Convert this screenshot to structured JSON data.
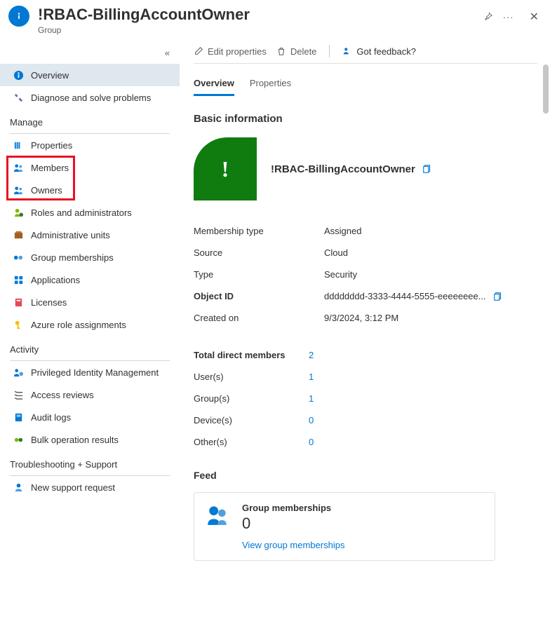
{
  "header": {
    "title": "!RBAC-BillingAccountOwner",
    "subtitle": "Group"
  },
  "sidebar": {
    "items": [
      {
        "label": "Overview",
        "icon": "info",
        "active": true
      },
      {
        "label": "Diagnose and solve problems",
        "icon": "wrench"
      }
    ],
    "manage_heading": "Manage",
    "manage": [
      {
        "label": "Properties",
        "icon": "props"
      },
      {
        "label": "Members",
        "icon": "people"
      },
      {
        "label": "Owners",
        "icon": "people"
      },
      {
        "label": "Roles and administrators",
        "icon": "role"
      },
      {
        "label": "Administrative units",
        "icon": "adminunit"
      },
      {
        "label": "Group memberships",
        "icon": "groupmem"
      },
      {
        "label": "Applications",
        "icon": "apps"
      },
      {
        "label": "Licenses",
        "icon": "license"
      },
      {
        "label": "Azure role assignments",
        "icon": "key"
      }
    ],
    "activity_heading": "Activity",
    "activity": [
      {
        "label": "Privileged Identity Management",
        "icon": "pim"
      },
      {
        "label": "Access reviews",
        "icon": "checklist"
      },
      {
        "label": "Audit logs",
        "icon": "book"
      },
      {
        "label": "Bulk operation results",
        "icon": "bulk"
      }
    ],
    "support_heading": "Troubleshooting + Support",
    "support": [
      {
        "label": "New support request",
        "icon": "support"
      }
    ]
  },
  "toolbar": {
    "edit": "Edit properties",
    "delete": "Delete",
    "feedback": "Got feedback?"
  },
  "tabs": {
    "overview": "Overview",
    "properties": "Properties"
  },
  "basic_info": {
    "heading": "Basic information",
    "name": "!RBAC-BillingAccountOwner",
    "tile_char": "!",
    "rows": [
      {
        "label": "Membership type",
        "value": "Assigned"
      },
      {
        "label": "Source",
        "value": "Cloud"
      },
      {
        "label": "Type",
        "value": "Security"
      },
      {
        "label": "Object ID",
        "value": "dddddddd-3333-4444-5555-eeeeeeee...",
        "copy": true
      },
      {
        "label": "Created on",
        "value": "9/3/2024, 3:12 PM"
      }
    ]
  },
  "counts": [
    {
      "label": "Total direct members",
      "value": "2"
    },
    {
      "label": "User(s)",
      "value": "1"
    },
    {
      "label": "Group(s)",
      "value": "1"
    },
    {
      "label": "Device(s)",
      "value": "0"
    },
    {
      "label": "Other(s)",
      "value": "0"
    }
  ],
  "feed": {
    "heading": "Feed",
    "card_title": "Group memberships",
    "card_number": "0",
    "card_link": "View group memberships"
  }
}
